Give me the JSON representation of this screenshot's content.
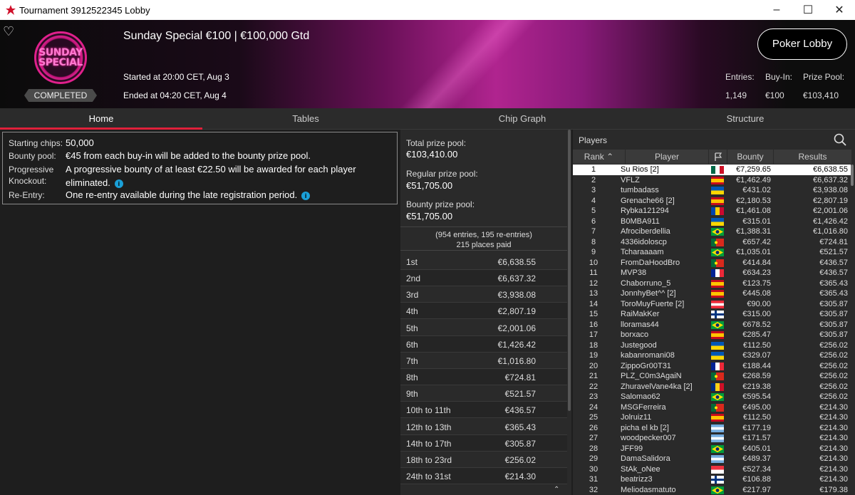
{
  "window": {
    "title": "Tournament 3912522345 Lobby"
  },
  "header": {
    "tournament_name": "Sunday Special €100 | €100,000 Gtd",
    "badge_text_1": "SUNDAY",
    "badge_text_2": "SPECIAL",
    "status": "COMPLETED",
    "started": "Started at 20:00 CET, Aug 3",
    "ended": "Ended at 04:20 CET, Aug 4",
    "lobby_button": "Poker Lobby",
    "entries_label": "Entries:",
    "entries_value": "1,149",
    "buyin_label": "Buy-In:",
    "buyin_value": "€100",
    "prizepool_label": "Prize Pool:",
    "prizepool_value": "€103,410"
  },
  "tabs": [
    "Home",
    "Tables",
    "Chip Graph",
    "Structure"
  ],
  "info": {
    "starting_chips_label": "Starting chips:",
    "starting_chips": "50,000",
    "bounty_pool_label": "Bounty pool:",
    "bounty_pool": "€45 from each buy-in will be added to the bounty prize pool.",
    "pko_label_1": "Progressive",
    "pko_label_2": "Knockout:",
    "pko_text_1": "A progressive bounty of at least €22.50 will be awarded for each player",
    "pko_text_2": "eliminated.",
    "reentry_label": "Re-Entry:",
    "reentry": "One re-entry available during the late registration period."
  },
  "prizes": {
    "total_label": "Total prize pool:",
    "total": "€103,410.00",
    "regular_label": "Regular prize pool:",
    "regular": "€51,705.00",
    "bounty_label": "Bounty prize pool:",
    "bounty": "€51,705.00",
    "entries_note": "(954 entries, 195 re-entries)",
    "places_paid": "215 places paid",
    "rows": [
      {
        "place": "1st",
        "amount": "€6,638.55"
      },
      {
        "place": "2nd",
        "amount": "€6,637.32"
      },
      {
        "place": "3rd",
        "amount": "€3,938.08"
      },
      {
        "place": "4th",
        "amount": "€2,807.19"
      },
      {
        "place": "5th",
        "amount": "€2,001.06"
      },
      {
        "place": "6th",
        "amount": "€1,426.42"
      },
      {
        "place": "7th",
        "amount": "€1,016.80"
      },
      {
        "place": "8th",
        "amount": "€724.81"
      },
      {
        "place": "9th",
        "amount": "€521.57"
      },
      {
        "place": "10th to 11th",
        "amount": "€436.57"
      },
      {
        "place": "12th to 13th",
        "amount": "€365.43"
      },
      {
        "place": "14th to 17th",
        "amount": "€305.87"
      },
      {
        "place": "18th to 23rd",
        "amount": "€256.02"
      },
      {
        "place": "24th to 31st",
        "amount": "€214.30"
      }
    ]
  },
  "players": {
    "title": "Players",
    "col_rank": "Rank",
    "col_player": "Player",
    "col_bounty": "Bounty",
    "col_results": "Results",
    "rows": [
      {
        "rank": "1",
        "name": "Su Rios [2]",
        "bounty": "€7,259.65",
        "result": "€6,638.55",
        "flag": "mx"
      },
      {
        "rank": "2",
        "name": "VFLZ",
        "bounty": "€1,462.49",
        "result": "€6,637.32",
        "flag": "es"
      },
      {
        "rank": "3",
        "name": "tumbadass",
        "bounty": "€431.02",
        "result": "€3,938.08",
        "flag": "ua"
      },
      {
        "rank": "4",
        "name": "Grenache66 [2]",
        "bounty": "€2,180.53",
        "result": "€2,807.19",
        "flag": "es"
      },
      {
        "rank": "5",
        "name": "Rybka121294",
        "bounty": "€1,461.08",
        "result": "€2,001.06",
        "flag": "md"
      },
      {
        "rank": "6",
        "name": "B0MBA911",
        "bounty": "€315.01",
        "result": "€1,426.42",
        "flag": "ua"
      },
      {
        "rank": "7",
        "name": "Afrociberdellia",
        "bounty": "€1,388.31",
        "result": "€1,016.80",
        "flag": "br"
      },
      {
        "rank": "8",
        "name": "4336idoloscp",
        "bounty": "€657.42",
        "result": "€724.81",
        "flag": "pt"
      },
      {
        "rank": "9",
        "name": "Tcharaaaam",
        "bounty": "€1,035.01",
        "result": "€521.57",
        "flag": "br"
      },
      {
        "rank": "10",
        "name": "FromDaHoodBro",
        "bounty": "€414.84",
        "result": "€436.57",
        "flag": "pt"
      },
      {
        "rank": "11",
        "name": "MVP38",
        "bounty": "€634.23",
        "result": "€436.57",
        "flag": "fr"
      },
      {
        "rank": "12",
        "name": "Chaborruno_5",
        "bounty": "€123.75",
        "result": "€365.43",
        "flag": "es"
      },
      {
        "rank": "13",
        "name": "JonnhyBet^^ [2]",
        "bounty": "€445.08",
        "result": "€365.43",
        "flag": "es"
      },
      {
        "rank": "14",
        "name": "ToroMuyFuerte [2]",
        "bounty": "€90.00",
        "result": "€305.87",
        "flag": "at"
      },
      {
        "rank": "15",
        "name": "RaiMakKer",
        "bounty": "€315.00",
        "result": "€305.87",
        "flag": "fi"
      },
      {
        "rank": "16",
        "name": "lloramas44",
        "bounty": "€678.52",
        "result": "€305.87",
        "flag": "br"
      },
      {
        "rank": "17",
        "name": "borxaco",
        "bounty": "€285.47",
        "result": "€305.87",
        "flag": "es"
      },
      {
        "rank": "18",
        "name": "Justegood",
        "bounty": "€112.50",
        "result": "€256.02",
        "flag": "ua"
      },
      {
        "rank": "19",
        "name": "kabanromani08",
        "bounty": "€329.07",
        "result": "€256.02",
        "flag": "ua"
      },
      {
        "rank": "20",
        "name": "ZippoGr00T31",
        "bounty": "€188.44",
        "result": "€256.02",
        "flag": "fr"
      },
      {
        "rank": "21",
        "name": "PLZ_C0m3AgaiN",
        "bounty": "€268.59",
        "result": "€256.02",
        "flag": "pt"
      },
      {
        "rank": "22",
        "name": "ZhuravelVane4ka [2]",
        "bounty": "€219.38",
        "result": "€256.02",
        "flag": "ro"
      },
      {
        "rank": "23",
        "name": "Salomao62",
        "bounty": "€595.54",
        "result": "€256.02",
        "flag": "br"
      },
      {
        "rank": "24",
        "name": "MSGFerreira",
        "bounty": "€495.00",
        "result": "€214.30",
        "flag": "pt"
      },
      {
        "rank": "25",
        "name": "Jolruiz11",
        "bounty": "€112.50",
        "result": "€214.30",
        "flag": "es"
      },
      {
        "rank": "26",
        "name": "picha el kb [2]",
        "bounty": "€177.19",
        "result": "€214.30",
        "flag": "ar"
      },
      {
        "rank": "27",
        "name": "woodpecker007",
        "bounty": "€171.57",
        "result": "€214.30",
        "flag": "ar"
      },
      {
        "rank": "28",
        "name": "JFF99",
        "bounty": "€405.01",
        "result": "€214.30",
        "flag": "br"
      },
      {
        "rank": "29",
        "name": "DamaSalidora",
        "bounty": "€489.37",
        "result": "€214.30",
        "flag": "ar"
      },
      {
        "rank": "30",
        "name": "StAk_oNee",
        "bounty": "€527.34",
        "result": "€214.30",
        "flag": "sg"
      },
      {
        "rank": "31",
        "name": "beatrizz3",
        "bounty": "€106.88",
        "result": "€214.30",
        "flag": "fi"
      },
      {
        "rank": "32",
        "name": "Meliodasmatuto",
        "bounty": "€217.97",
        "result": "€179.38",
        "flag": "br"
      }
    ]
  },
  "colors": {
    "accent": "#e0203a",
    "header_magenta": "#b0248f",
    "info_icon": "#1aa0d8"
  }
}
